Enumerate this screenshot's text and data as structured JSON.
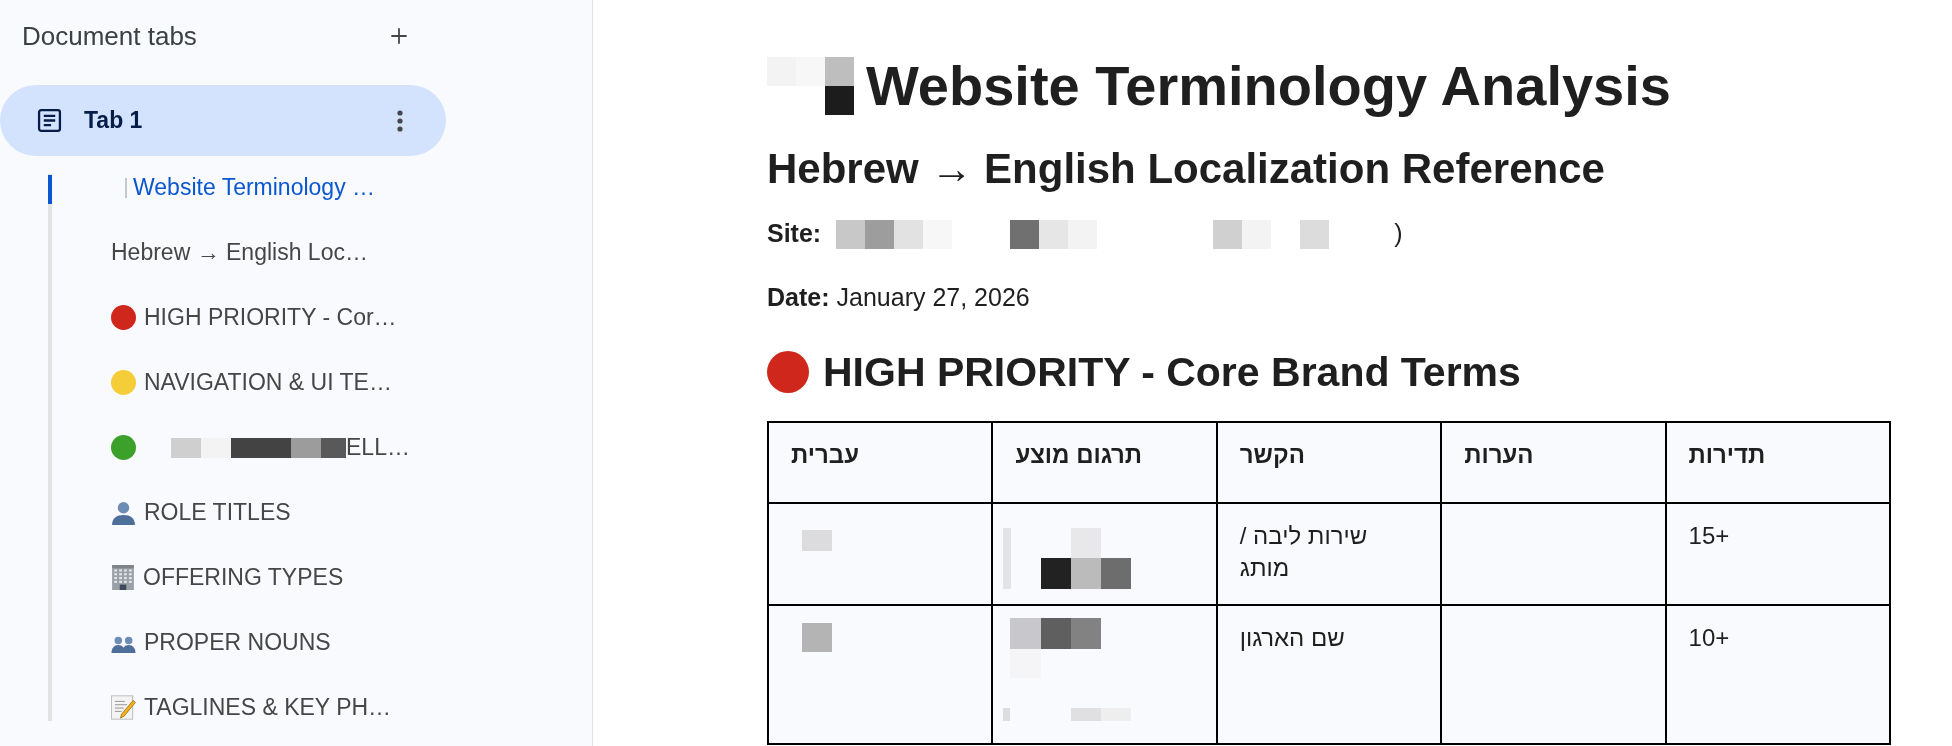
{
  "sidebar": {
    "title": "Document tabs",
    "tabs": [
      {
        "label": "Tab 1",
        "selected": true,
        "children": [
          {
            "label": "Website Terminology …",
            "selected": true,
            "redacted_prefix": true
          },
          {
            "label": "Hebrew → English Loc…",
            "selected": false,
            "redacted_prefix": false
          },
          {
            "label": "HIGH PRIORITY - Cor…",
            "selected": false,
            "redacted_prefix": false,
            "color": "#d0271d"
          },
          {
            "label": "NAVIGATION & UI TE…",
            "selected": false,
            "redacted_prefix": false,
            "color": "#f4cd38"
          },
          {
            "label": "ELL…",
            "selected": false,
            "redacted_prefix": true,
            "color": "#3ba12a"
          },
          {
            "label": "ROLE TITLES",
            "selected": false,
            "redacted_prefix": false
          },
          {
            "label": "OFFERING TYPES",
            "selected": false,
            "redacted_prefix": false
          },
          {
            "label": "PROPER NOUNS",
            "selected": false,
            "redacted_prefix": false
          },
          {
            "label": "TAGLINES & KEY PH…",
            "selected": false,
            "redacted_prefix": false
          }
        ]
      }
    ]
  },
  "document": {
    "title": {
      "text": "Website Terminology Analysis",
      "redacted_prefix": true
    },
    "subtitle": "Hebrew → English Localization Reference",
    "fields": [
      {
        "label": "Site:",
        "value": ")",
        "redacted": true
      },
      {
        "label": "Date:",
        "value": "January 27, 2026",
        "redacted": false
      }
    ],
    "section": {
      "title": "HIGH PRIORITY - Core Brand Terms",
      "color": "#d0271d",
      "table": {
        "columns": [
          "עברית",
          "תרגום מוצע",
          "הקשר",
          "הערות",
          "תדירות"
        ],
        "rows": [
          [
            {
              "redacted": true
            },
            {
              "redacted": true
            },
            {
              "text": "שירות ליבה / מותג",
              "redacted": false
            },
            {
              "redacted": false
            },
            {
              "text": "15+",
              "redacted": false
            }
          ],
          [
            {
              "redacted": true
            },
            {
              "redacted": true
            },
            {
              "text": "שם הארגון",
              "redacted": false
            },
            {
              "redacted": false
            },
            {
              "text": "10+",
              "redacted": false
            }
          ]
        ]
      }
    }
  }
}
